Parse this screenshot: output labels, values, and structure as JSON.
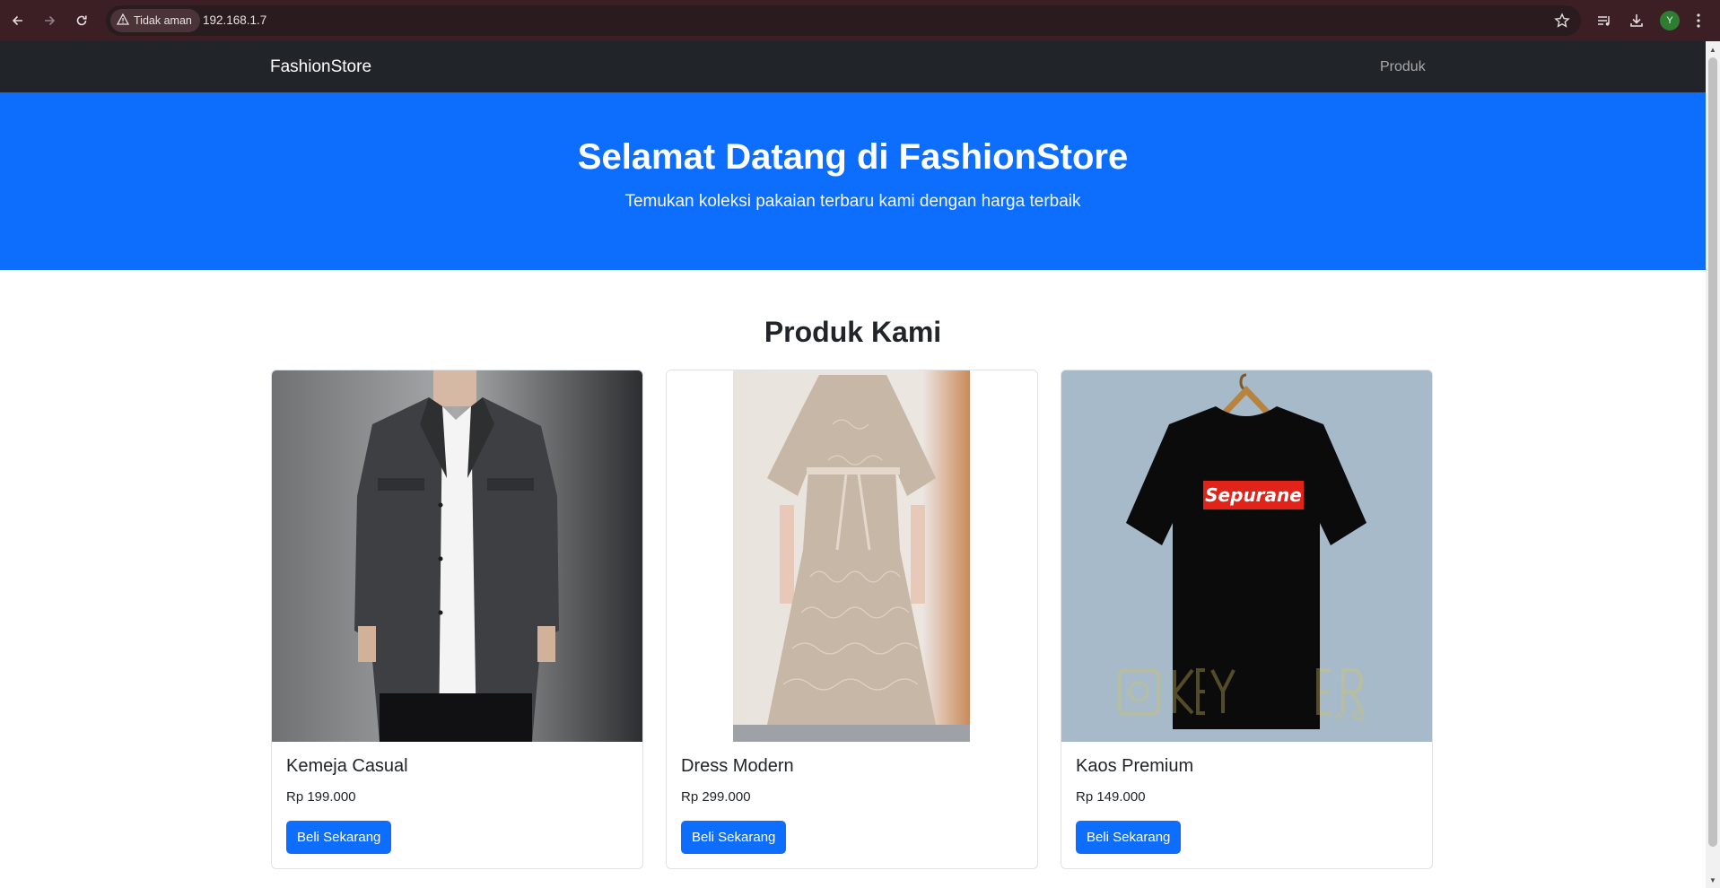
{
  "browser": {
    "security_label": "Tidak aman",
    "url": "192.168.1.7",
    "profile_initial": "Y"
  },
  "navbar": {
    "brand": "FashionStore",
    "links": [
      "Produk"
    ]
  },
  "hero": {
    "title": "Selamat Datang di FashionStore",
    "subtitle": "Temukan koleksi pakaian terbaru kami dengan harga terbaik"
  },
  "products_section": {
    "title": "Produk Kami",
    "items": [
      {
        "name": "Kemeja Casual",
        "price": "Rp 199.000",
        "button": "Beli Sekarang"
      },
      {
        "name": "Dress Modern",
        "price": "Rp 299.000",
        "button": "Beli Sekarang"
      },
      {
        "name": "Kaos Premium",
        "price": "Rp 149.000",
        "button": "Beli Sekarang",
        "shirt_print": "Sepurane"
      }
    ]
  },
  "colors": {
    "primary": "#0d6efd",
    "navbar_bg": "#212529",
    "browser_frame": "#3c1f24"
  }
}
